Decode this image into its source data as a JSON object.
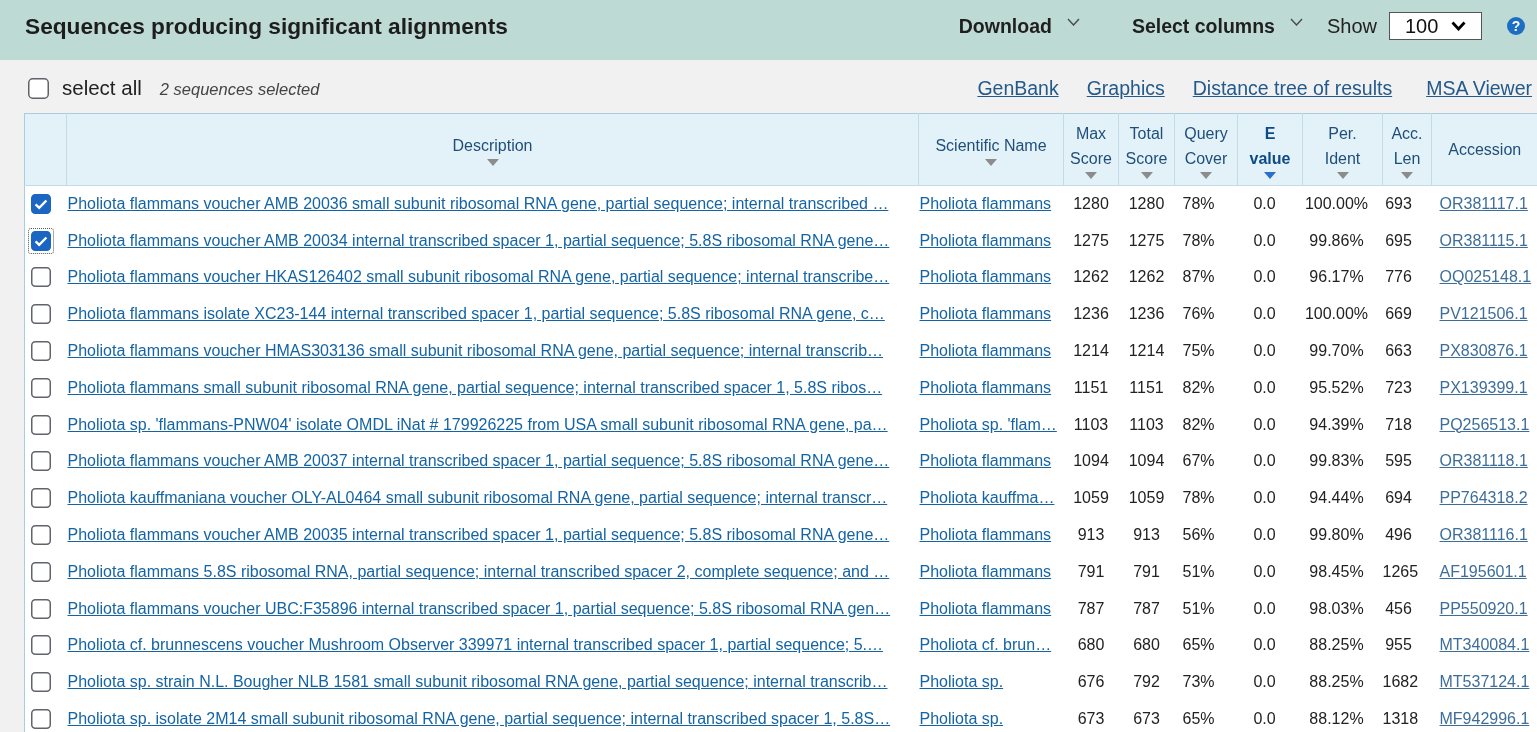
{
  "header": {
    "title": "Sequences producing significant alignments",
    "menus": [
      {
        "label": "Download"
      },
      {
        "label": "Select columns"
      }
    ],
    "show": {
      "label": "Show",
      "value": "100"
    },
    "help": "?"
  },
  "toolbar": {
    "select_all": {
      "label": "select all",
      "checked": false
    },
    "selection_count": "2 sequences selected",
    "links": [
      "GenBank",
      "Graphics",
      "Distance tree of results",
      "MSA Viewer"
    ]
  },
  "table": {
    "columns": [
      {
        "label": "Description",
        "kind": "link",
        "sortable": true,
        "sorted": false
      },
      {
        "label": "Scientific Name",
        "kind": "link",
        "sortable": true,
        "sorted": false
      },
      {
        "label": "Max Score",
        "kind": "number",
        "sortable": true,
        "sorted": false
      },
      {
        "label": "Total Score",
        "kind": "number",
        "sortable": true,
        "sorted": false
      },
      {
        "label": "Query Cover",
        "kind": "number",
        "sortable": true,
        "sorted": false
      },
      {
        "label": "E value",
        "kind": "number",
        "sortable": true,
        "sorted": true
      },
      {
        "label": "Per. Ident",
        "kind": "number",
        "sortable": true,
        "sorted": false
      },
      {
        "label": "Acc. Len",
        "kind": "number",
        "sortable": true,
        "sorted": false
      },
      {
        "label": "Accession",
        "kind": "link",
        "sortable": false,
        "sorted": false
      }
    ],
    "rows": [
      {
        "selected": true,
        "focused": false,
        "description": "Pholiota flammans voucher AMB 20036 small subunit ribosomal RNA gene, partial sequence; internal transcribed …",
        "scientific_name": "Pholiota flammans",
        "max_score": "1280",
        "total_score": "1280",
        "query_cover": "78%",
        "e_value": "0.0",
        "per_ident": "100.00%",
        "acc_len": "693",
        "accession": "OR381117.1"
      },
      {
        "selected": true,
        "focused": true,
        "description": "Pholiota flammans voucher AMB 20034 internal transcribed spacer 1, partial sequence; 5.8S ribosomal RNA gene…",
        "scientific_name": "Pholiota flammans",
        "max_score": "1275",
        "total_score": "1275",
        "query_cover": "78%",
        "e_value": "0.0",
        "per_ident": "99.86%",
        "acc_len": "695",
        "accession": "OR381115.1"
      },
      {
        "selected": false,
        "focused": false,
        "description": "Pholiota flammans voucher HKAS126402 small subunit ribosomal RNA gene, partial sequence; internal transcribe…",
        "scientific_name": "Pholiota flammans",
        "max_score": "1262",
        "total_score": "1262",
        "query_cover": "87%",
        "e_value": "0.0",
        "per_ident": "96.17%",
        "acc_len": "776",
        "accession": "OQ025148.1"
      },
      {
        "selected": false,
        "focused": false,
        "description": "Pholiota flammans isolate XC23-144 internal transcribed spacer 1, partial sequence; 5.8S ribosomal RNA gene, c…",
        "scientific_name": "Pholiota flammans",
        "max_score": "1236",
        "total_score": "1236",
        "query_cover": "76%",
        "e_value": "0.0",
        "per_ident": "100.00%",
        "acc_len": "669",
        "accession": "PV121506.1"
      },
      {
        "selected": false,
        "focused": false,
        "description": "Pholiota flammans voucher HMAS303136 small subunit ribosomal RNA gene, partial sequence; internal transcrib…",
        "scientific_name": "Pholiota flammans",
        "max_score": "1214",
        "total_score": "1214",
        "query_cover": "75%",
        "e_value": "0.0",
        "per_ident": "99.70%",
        "acc_len": "663",
        "accession": "PX830876.1"
      },
      {
        "selected": false,
        "focused": false,
        "description": "Pholiota flammans small subunit ribosomal RNA gene, partial sequence; internal transcribed spacer 1, 5.8S ribos…",
        "scientific_name": "Pholiota flammans",
        "max_score": "1151",
        "total_score": "1151",
        "query_cover": "82%",
        "e_value": "0.0",
        "per_ident": "95.52%",
        "acc_len": "723",
        "accession": "PX139399.1"
      },
      {
        "selected": false,
        "focused": false,
        "description": "Pholiota sp. 'flammans-PNW04' isolate OMDL iNat # 179926225 from USA small subunit ribosomal RNA gene, pa…",
        "scientific_name": "Pholiota sp. 'flam…",
        "max_score": "1103",
        "total_score": "1103",
        "query_cover": "82%",
        "e_value": "0.0",
        "per_ident": "94.39%",
        "acc_len": "718",
        "accession": "PQ256513.1"
      },
      {
        "selected": false,
        "focused": false,
        "description": "Pholiota flammans voucher AMB 20037 internal transcribed spacer 1, partial sequence; 5.8S ribosomal RNA gene…",
        "scientific_name": "Pholiota flammans",
        "max_score": "1094",
        "total_score": "1094",
        "query_cover": "67%",
        "e_value": "0.0",
        "per_ident": "99.83%",
        "acc_len": "595",
        "accession": "OR381118.1"
      },
      {
        "selected": false,
        "focused": false,
        "description": "Pholiota kauffmaniana voucher OLY-AL0464 small subunit ribosomal RNA gene, partial sequence; internal transcr…",
        "scientific_name": "Pholiota kauffma…",
        "max_score": "1059",
        "total_score": "1059",
        "query_cover": "78%",
        "e_value": "0.0",
        "per_ident": "94.44%",
        "acc_len": "694",
        "accession": "PP764318.2"
      },
      {
        "selected": false,
        "focused": false,
        "description": "Pholiota flammans voucher AMB 20035 internal transcribed spacer 1, partial sequence; 5.8S ribosomal RNA gene…",
        "scientific_name": "Pholiota flammans",
        "max_score": "913",
        "total_score": "913",
        "query_cover": "56%",
        "e_value": "0.0",
        "per_ident": "99.80%",
        "acc_len": "496",
        "accession": "OR381116.1"
      },
      {
        "selected": false,
        "focused": false,
        "description": "Pholiota flammans 5.8S ribosomal RNA, partial sequence; internal transcribed spacer 2, complete sequence; and …",
        "scientific_name": "Pholiota flammans",
        "max_score": "791",
        "total_score": "791",
        "query_cover": "51%",
        "e_value": "0.0",
        "per_ident": "98.45%",
        "acc_len": "1265",
        "accession": "AF195601.1"
      },
      {
        "selected": false,
        "focused": false,
        "description": "Pholiota flammans voucher UBC:F35896 internal transcribed spacer 1, partial sequence; 5.8S ribosomal RNA gen…",
        "scientific_name": "Pholiota flammans",
        "max_score": "787",
        "total_score": "787",
        "query_cover": "51%",
        "e_value": "0.0",
        "per_ident": "98.03%",
        "acc_len": "456",
        "accession": "PP550920.1"
      },
      {
        "selected": false,
        "focused": false,
        "description": "Pholiota cf. brunnescens voucher Mushroom Observer 339971 internal transcribed spacer 1, partial sequence; 5.…",
        "scientific_name": "Pholiota cf. brun…",
        "max_score": "680",
        "total_score": "680",
        "query_cover": "65%",
        "e_value": "0.0",
        "per_ident": "88.25%",
        "acc_len": "955",
        "accession": "MT340084.1"
      },
      {
        "selected": false,
        "focused": false,
        "description": "Pholiota sp. strain N.L. Bougher NLB 1581 small subunit ribosomal RNA gene, partial sequence; internal transcrib…",
        "scientific_name": "Pholiota sp.",
        "max_score": "676",
        "total_score": "792",
        "query_cover": "73%",
        "e_value": "0.0",
        "per_ident": "88.25%",
        "acc_len": "1682",
        "accession": "MT537124.1"
      },
      {
        "selected": false,
        "focused": false,
        "description": "Pholiota sp. isolate 2M14 small subunit ribosomal RNA gene, partial sequence; internal transcribed spacer 1, 5.8S…",
        "scientific_name": "Pholiota sp.",
        "max_score": "673",
        "total_score": "673",
        "query_cover": "65%",
        "e_value": "0.0",
        "per_ident": "88.12%",
        "acc_len": "1318",
        "accession": "MF942996.1"
      }
    ]
  }
}
